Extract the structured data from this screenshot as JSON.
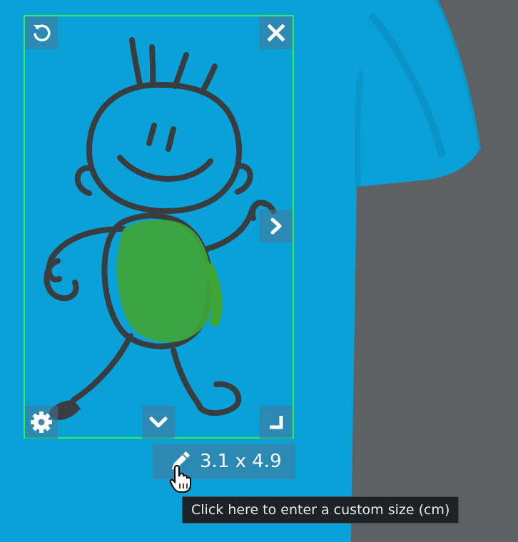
{
  "colors": {
    "shirt": "#0aa0d8",
    "background": "#5e6163",
    "selection_border": "#33ee55",
    "drawing_stroke": "#3a3d40",
    "drawing_fill": "#3fa535"
  },
  "design_size": {
    "label": "3.1 x 4.9",
    "icon": "pencil-icon"
  },
  "tooltip": {
    "text": "Click here to enter a custom size (cm)"
  },
  "controls": {
    "rotate": "rotate-icon",
    "remove": "close-icon",
    "next": "chevron-right-icon",
    "settings": "gear-icon",
    "more": "chevron-down-icon",
    "resize": "resize-corner-icon"
  }
}
